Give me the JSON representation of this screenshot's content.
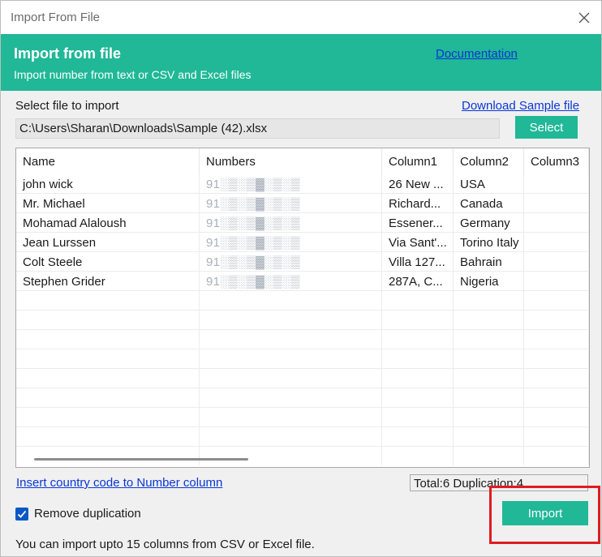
{
  "window": {
    "title": "Import From File",
    "close_icon": "close-icon"
  },
  "banner": {
    "heading": "Import from file",
    "subtext": "Import number from text or CSV and Excel files",
    "doc_link": "Documentation",
    "color": "#20b897"
  },
  "file": {
    "label": "Select file to import",
    "download_link": "Download Sample file",
    "path": "C:\\Users\\Sharan\\Downloads\\Sample (42).xlsx",
    "select_label": "Select"
  },
  "table": {
    "columns": [
      "Name",
      "Numbers",
      "Column1",
      "Column2",
      "Column3"
    ],
    "rows": [
      [
        "john wick",
        "91░▒░▒▓░▒░▒",
        "26 New ...",
        "USA",
        ""
      ],
      [
        "Mr. Michael",
        "91░▒░▒▓░▒░▒",
        "Richard...",
        "Canada",
        ""
      ],
      [
        "Mohamad Alaloush",
        "91░▒░▒▓░▒░▒",
        "Essener...",
        "Germany",
        ""
      ],
      [
        "Jean Lurssen",
        "91░▒░▒▓░▒░▒",
        "Via Sant'...",
        "Torino Italy",
        ""
      ],
      [
        "Colt Steele",
        "91░▒░▒▓░▒░▒",
        "Villa 127...",
        "Bahrain",
        ""
      ],
      [
        "Stephen Grider",
        "91░▒░▒▓░▒░▒",
        "287A, C...",
        "Nigeria",
        ""
      ]
    ]
  },
  "footer": {
    "insert_link": "Insert country code to Number column",
    "total_text": "Total:6 Duplication:4",
    "checkbox_label": "Remove duplication",
    "checkbox_checked": true,
    "import_label": "Import",
    "note": "You can import upto 15 columns from CSV or Excel file."
  },
  "colors": {
    "accent": "#20b897",
    "link": "#0a36d6",
    "highlight": "#e01b22"
  }
}
